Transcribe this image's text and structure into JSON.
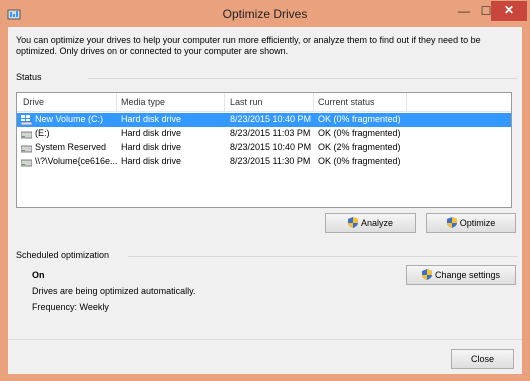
{
  "window": {
    "title": "Optimize Drives",
    "minimize_glyph": "—",
    "maximize_glyph": "☐",
    "close_glyph": "✕"
  },
  "intro": "You can optimize your drives to help your computer run more efficiently, or analyze them to find out if they need to be optimized. Only drives on or connected to your computer are shown.",
  "status": {
    "label": "Status",
    "columns": [
      "Drive",
      "Media type",
      "Last run",
      "Current status"
    ],
    "rows": [
      {
        "drive": "New Volume (C:)",
        "media": "Hard disk drive",
        "last_run": "8/23/2015 10:40 PM",
        "status": "OK (0% fragmented)",
        "icon": "windows-drive-icon"
      },
      {
        "drive": "(E:)",
        "media": "Hard disk drive",
        "last_run": "8/23/2015 11:03 PM",
        "status": "OK (0% fragmented)",
        "icon": "hard-drive-icon"
      },
      {
        "drive": "System Reserved",
        "media": "Hard disk drive",
        "last_run": "8/23/2015 10:40 PM",
        "status": "OK (2% fragmented)",
        "icon": "hard-drive-icon"
      },
      {
        "drive": "\\\\?\\Volume{ce616e...",
        "media": "Hard disk drive",
        "last_run": "8/23/2015 11:30 PM",
        "status": "OK (0% fragmented)",
        "icon": "hard-drive-icon"
      }
    ],
    "selected_index": 0
  },
  "buttons": {
    "analyze": "Analyze",
    "optimize": "Optimize",
    "change_settings": "Change settings",
    "close": "Close"
  },
  "scheduled": {
    "label": "Scheduled optimization",
    "state": "On",
    "description": "Drives are being optimized automatically.",
    "frequency": "Frequency: Weekly"
  },
  "colors": {
    "accent": "#3399ff",
    "title_bar": "#eaa27e",
    "close_button": "#c9463d"
  }
}
